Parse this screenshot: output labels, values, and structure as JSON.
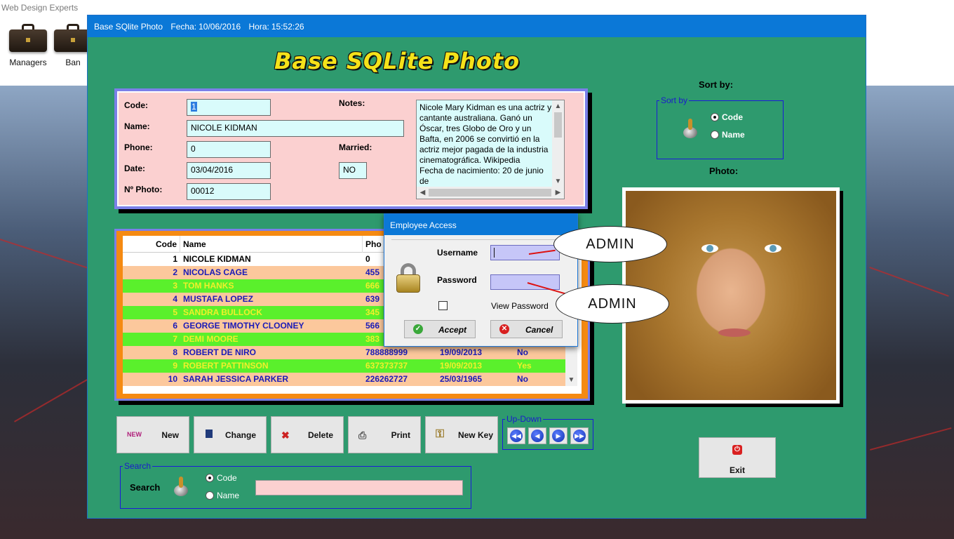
{
  "desktop": {
    "title": "Web Design Experts",
    "icons": [
      {
        "label": "Managers",
        "icon": "briefcase-icon"
      },
      {
        "label": "Ban",
        "icon": "briefcase-icon"
      }
    ]
  },
  "window": {
    "title": "Base SQlite Photo",
    "fecha_label": "Fecha:",
    "fecha": "10/06/2016",
    "hora_label": "Hora:",
    "hora": "15:52:26",
    "app_title": "Base SQLite Photo"
  },
  "record": {
    "code_label": "Code:",
    "code": "1",
    "name_label": "Name:",
    "name": "NICOLE KIDMAN",
    "phone_label": "Phone:",
    "phone": "0",
    "date_label": "Date:",
    "date": "03/04/2016",
    "photo_label": "Nº Photo:",
    "photo": "00012",
    "notes_label": "Notes:",
    "notes": "Nicole Mary Kidman es una actriz y cantante australiana. Ganó un Óscar, tres Globo de Oro y un Bafta, en 2006 se convirtió en la actriz mejor pagada de la industria cinematográfica. Wikipedia\nFecha de nacimiento: 20 de junio de",
    "married_label": "Married:",
    "married": "NO"
  },
  "grid": {
    "headers": [
      "Code",
      "Name",
      "Pho",
      "",
      ""
    ],
    "rows": [
      {
        "code": "1",
        "name": "NICOLE KIDMAN",
        "phone": "0",
        "date": "",
        "married": "",
        "style": "white"
      },
      {
        "code": "2",
        "name": "NICOLAS CAGE",
        "phone": "455",
        "date": "",
        "married": "",
        "style": "peach"
      },
      {
        "code": "3",
        "name": "TOM HANKS",
        "phone": "666",
        "date": "",
        "married": "",
        "style": "green"
      },
      {
        "code": "4",
        "name": "MUSTAFA LOPEZ",
        "phone": "639",
        "date": "",
        "married": "",
        "style": "peach"
      },
      {
        "code": "5",
        "name": "SANDRA BULLOCK",
        "phone": "345",
        "date": "",
        "married": "",
        "style": "green"
      },
      {
        "code": "6",
        "name": "GEORGE TIMOTHY CLOONEY",
        "phone": "566",
        "date": "",
        "married": "",
        "style": "peach"
      },
      {
        "code": "7",
        "name": "DEMI MOORE",
        "phone": "383",
        "date": "",
        "married": "",
        "style": "green"
      },
      {
        "code": "8",
        "name": "ROBERT  DE NIRO",
        "phone": "788888999",
        "date": "19/09/2013",
        "married": "No",
        "style": "peach"
      },
      {
        "code": "9",
        "name": "ROBERT PATTINSON",
        "phone": "637373737",
        "date": "19/09/2013",
        "married": "Yes",
        "style": "green"
      },
      {
        "code": "10",
        "name": "SARAH JESSICA PARKER",
        "phone": "226262727",
        "date": "25/03/1965",
        "married": "No",
        "style": "peach"
      }
    ]
  },
  "buttons": {
    "new": "New",
    "change": "Change",
    "delete": "Delete",
    "print": "Print",
    "new_key": "New Key",
    "exit": "Exit"
  },
  "updown": {
    "title": "Up-Down"
  },
  "search": {
    "group_title": "Search",
    "label": "Search",
    "opt_code": "Code",
    "opt_name": "Name",
    "value": ""
  },
  "sort": {
    "heading": "Sort by:",
    "group_title": "Sort by",
    "opt_code": "Code",
    "opt_name": "Name"
  },
  "photo": {
    "heading": "Photo:"
  },
  "dialog": {
    "title": "Employee Access",
    "username_label": "Username",
    "password_label": "Password",
    "view_password": "View Password",
    "accept": "Accept",
    "cancel": "Cancel",
    "username_value": "",
    "password_value": ""
  },
  "callouts": {
    "username": "ADMIN",
    "password": "ADMIN"
  },
  "colors": {
    "window_bg": "#2e9a6e",
    "title_bar": "#0b78d7",
    "row_peach": "#fcc89c",
    "row_green": "#5af02c",
    "grid_border": "#f58a12",
    "panel_border": "#7b7fe8"
  }
}
